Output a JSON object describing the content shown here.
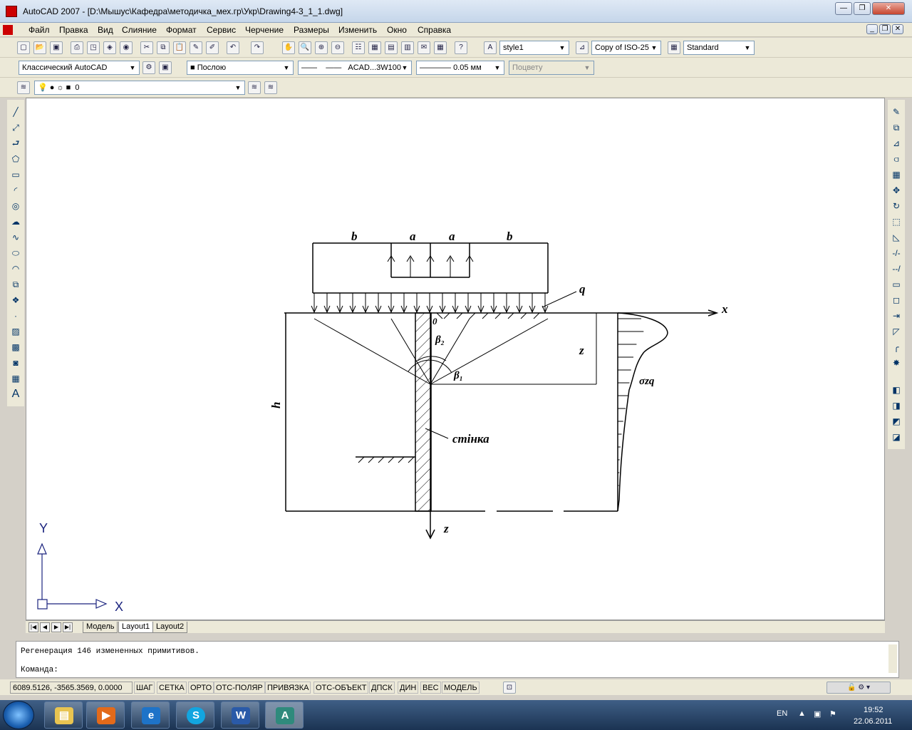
{
  "window": {
    "title": "AutoCAD 2007 - [D:\\Мышус\\Кафедра\\методичка_мех.гр\\Укр\\Drawing4-3_1_1.dwg]"
  },
  "menu": [
    "Файл",
    "Правка",
    "Вид",
    "Слияние",
    "Формат",
    "Сервис",
    "Черчение",
    "Размеры",
    "Изменить",
    "Окно",
    "Справка"
  ],
  "toolbar": {
    "text_style": "style1",
    "dim_style": "Copy of ISO-25",
    "table_style": "Standard",
    "workspace": "Классический AutoCAD",
    "color": "Послою",
    "linetype": "ACAD...3W100",
    "lineweight": "0.05 мм",
    "plot_style": "Поцвету",
    "layer": "0"
  },
  "drawing": {
    "labels": {
      "b_left": "b",
      "a_left": "a",
      "a_right": "a",
      "b_right": "b",
      "q": "q",
      "x": "x",
      "origin": "0",
      "beta2": "β₂",
      "beta1": "β₁",
      "z_dim": "z",
      "h": "h",
      "wall": "стінка",
      "sigma": "σzq",
      "z_axis": "z"
    },
    "ucs": {
      "y": "Y",
      "x": "X"
    }
  },
  "tabs": [
    "Модель",
    "Layout1",
    "Layout2"
  ],
  "command": {
    "history": "Регенерация 146 измененных примитивов.",
    "prompt": "Команда:"
  },
  "status": {
    "coords": "6089.5126, -3565.3569, 0.0000",
    "buttons": [
      "ШАГ",
      "СЕТКА",
      "ОРТО",
      "ОТС-ПОЛЯР",
      "ПРИВЯЗКА",
      "ОТС-ОБЪЕКТ",
      "ДПСК",
      "ДИН",
      "ВЕС",
      "МОДЕЛЬ"
    ]
  },
  "taskbar": {
    "lang": "EN",
    "time": "19:52",
    "date": "22.06.2011"
  }
}
